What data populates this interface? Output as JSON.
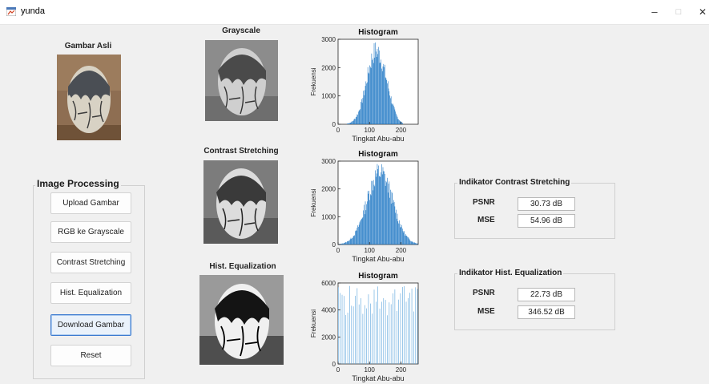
{
  "window": {
    "title": "yunda",
    "minimize_glyph": "–",
    "maximize_glyph": "□",
    "close_glyph": "✕"
  },
  "images": {
    "original_label": "Gambar Asli",
    "grayscale_label": "Grayscale",
    "contrast_label": "Contrast Stretching",
    "histeq_label": "Hist. Equalization"
  },
  "controls": {
    "title": "Image Processing",
    "buttons": {
      "upload": "Upload Gambar",
      "rgb_gray": "RGB ke Grayscale",
      "contrast": "Contrast Stretching",
      "histeq": "Hist. Equalization",
      "download": "Download Gambar",
      "reset": "Reset"
    }
  },
  "indicators": {
    "contrast": {
      "title": "Indikator Contrast Stretching",
      "psnr_label": "PSNR",
      "psnr_value": "30.73 dB",
      "mse_label": "MSE",
      "mse_value": "54.96 dB"
    },
    "histeq": {
      "title": "Indikator Hist. Equalization",
      "psnr_label": "PSNR",
      "psnr_value": "22.73 dB",
      "mse_label": "MSE",
      "mse_value": "346.52 dB"
    }
  },
  "colors": {
    "bar": "#1f77c4",
    "bar_light": "#5aa4dd"
  },
  "chart_data": [
    {
      "type": "bar",
      "title": "Histogram",
      "xlabel": "Tingkat Abu-abu",
      "ylabel": "Frekuensi",
      "xlim": [
        0,
        255
      ],
      "ylim": [
        0,
        3000
      ],
      "xticks": [
        0,
        100,
        200
      ],
      "yticks": [
        0,
        1000,
        2000,
        3000
      ],
      "shape": "grayscale"
    },
    {
      "type": "bar",
      "title": "Histogram",
      "xlabel": "Tingkat Abu-abu",
      "ylabel": "Frekuensi",
      "xlim": [
        0,
        255
      ],
      "ylim": [
        0,
        3000
      ],
      "xticks": [
        0,
        100,
        200
      ],
      "yticks": [
        0,
        1000,
        2000,
        3000
      ],
      "shape": "stretched"
    },
    {
      "type": "bar",
      "title": "Histogram",
      "xlabel": "Tingkat Abu-abu",
      "ylabel": "Frekuensi",
      "xlim": [
        0,
        255
      ],
      "ylim": [
        0,
        6000
      ],
      "xticks": [
        0,
        100,
        200
      ],
      "yticks": [
        0,
        2000,
        4000,
        6000
      ],
      "shape": "equalized"
    }
  ]
}
